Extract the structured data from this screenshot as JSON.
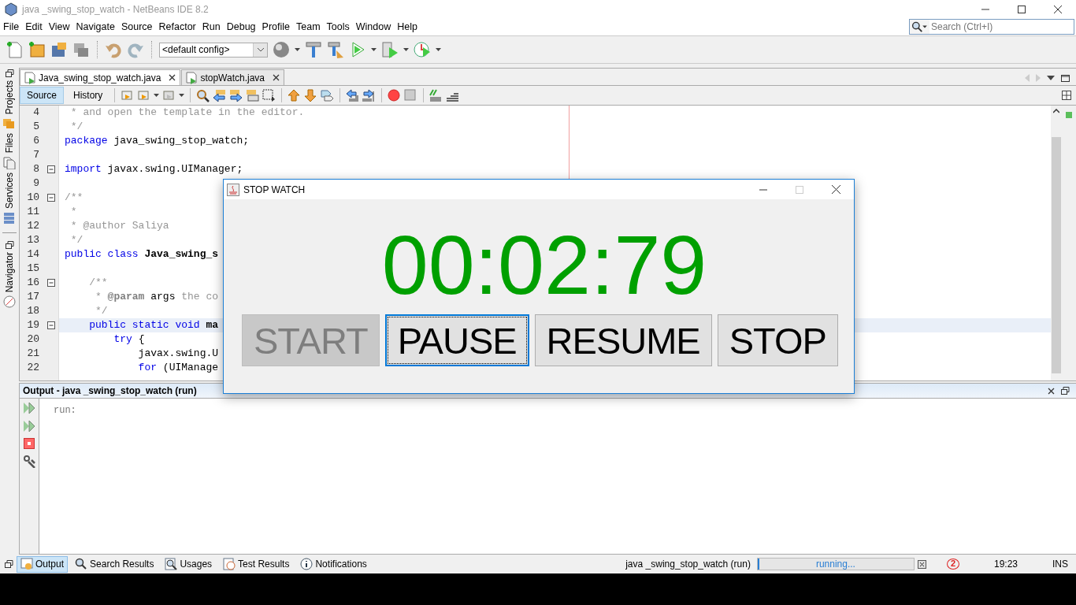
{
  "window": {
    "title": "java _swing_stop_watch - NetBeans IDE 8.2"
  },
  "menu": [
    "File",
    "Edit",
    "View",
    "Navigate",
    "Source",
    "Refactor",
    "Run",
    "Debug",
    "Profile",
    "Team",
    "Tools",
    "Window",
    "Help"
  ],
  "search": {
    "placeholder": "Search (Ctrl+I)"
  },
  "toolbar": {
    "config": "<default config>"
  },
  "side_tabs": [
    "Projects",
    "Files",
    "Services",
    "Navigator"
  ],
  "editor_tabs": [
    {
      "label": "Java_swing_stop_watch.java",
      "selected": true
    },
    {
      "label": "stopWatch.java",
      "selected": false
    }
  ],
  "view_tabs": [
    {
      "label": "Source",
      "selected": true
    },
    {
      "label": "History",
      "selected": false
    }
  ],
  "code": [
    {
      "number": "4",
      "fold": false,
      "current": false,
      "tokens": [
        {
          "text": " * and open the template in the editor.",
          "kind": "comment"
        }
      ]
    },
    {
      "number": "5",
      "fold": false,
      "current": false,
      "tokens": [
        {
          "text": " */",
          "kind": "comment"
        }
      ]
    },
    {
      "number": "6",
      "fold": false,
      "current": false,
      "tokens": [
        {
          "text": "package",
          "kind": "keyword"
        },
        {
          "text": " java_swing_stop_watch;",
          "kind": "plain"
        }
      ]
    },
    {
      "number": "7",
      "fold": false,
      "current": false
    },
    {
      "number": "8",
      "fold": true,
      "current": false,
      "tokens": [
        {
          "text": "import",
          "kind": "keyword"
        },
        {
          "text": " javax.swing.UIManager;",
          "kind": "plain"
        }
      ]
    },
    {
      "number": "9",
      "fold": false,
      "current": false
    },
    {
      "number": "10",
      "fold": true,
      "current": false,
      "tokens": [
        {
          "text": "/**",
          "kind": "comment"
        }
      ]
    },
    {
      "number": "11",
      "fold": false,
      "current": false,
      "tokens": [
        {
          "text": " *",
          "kind": "comment"
        }
      ]
    },
    {
      "number": "12",
      "fold": false,
      "current": false,
      "tokens": [
        {
          "text": " * @author Saliya",
          "kind": "comment"
        }
      ]
    },
    {
      "number": "13",
      "fold": false,
      "current": false,
      "tokens": [
        {
          "text": " */",
          "kind": "comment"
        }
      ]
    },
    {
      "number": "14",
      "fold": false,
      "current": false,
      "tokens": [
        {
          "text": "public class ",
          "kind": "keyword"
        },
        {
          "text": "Java_swing_s",
          "kind": "bold"
        }
      ]
    },
    {
      "number": "15",
      "fold": false,
      "current": false
    },
    {
      "number": "16",
      "fold": true,
      "current": false,
      "tokens": [
        {
          "text": "    /**",
          "kind": "comment"
        }
      ]
    },
    {
      "number": "17",
      "fold": false,
      "current": false,
      "tokens": [
        {
          "text": "     * ",
          "kind": "comment"
        },
        {
          "text": "@param",
          "kind": "tag"
        },
        {
          "text": " args",
          "kind": "plain"
        },
        {
          "text": " the co",
          "kind": "comment"
        }
      ]
    },
    {
      "number": "18",
      "fold": false,
      "current": false,
      "tokens": [
        {
          "text": "     */",
          "kind": "comment"
        }
      ]
    },
    {
      "number": "19",
      "fold": true,
      "current": true,
      "tokens": [
        {
          "text": "    public static void ",
          "kind": "keyword"
        },
        {
          "text": "ma",
          "kind": "bold"
        }
      ]
    },
    {
      "number": "20",
      "fold": false,
      "current": false,
      "tokens": [
        {
          "text": "        try",
          "kind": "keyword"
        },
        {
          "text": " {",
          "kind": "plain"
        }
      ]
    },
    {
      "number": "21",
      "fold": false,
      "current": false,
      "tokens": [
        {
          "text": "            javax.swing.U",
          "kind": "plain"
        }
      ]
    },
    {
      "number": "22",
      "fold": false,
      "current": false,
      "tokens": [
        {
          "text": "            for",
          "kind": "keyword"
        },
        {
          "text": " (UIManage",
          "kind": "plain"
        }
      ]
    }
  ],
  "output": {
    "title": "Output - java _swing_stop_watch (run)",
    "lines": [
      "run:"
    ]
  },
  "output_tabs": [
    {
      "label": "Output",
      "selected": true
    },
    {
      "label": "Search Results",
      "selected": false
    },
    {
      "label": "Usages",
      "selected": false
    },
    {
      "label": "Test Results",
      "selected": false
    },
    {
      "label": "Notifications",
      "selected": false
    }
  ],
  "status_bar": {
    "task": "java _swing_stop_watch (run)",
    "progress": {
      "text": "running...",
      "level": 0.01
    },
    "notifications": "2",
    "time": "19:23",
    "mode": "INS"
  },
  "dialog": {
    "title": "STOP WATCH",
    "time": "00:02:79",
    "buttons": [
      {
        "label": "START",
        "disabled": true,
        "focused": false
      },
      {
        "label": "PAUSE",
        "disabled": false,
        "focused": true
      },
      {
        "label": "RESUME",
        "disabled": false,
        "focused": false
      },
      {
        "label": "STOP",
        "disabled": false,
        "focused": false
      }
    ]
  }
}
